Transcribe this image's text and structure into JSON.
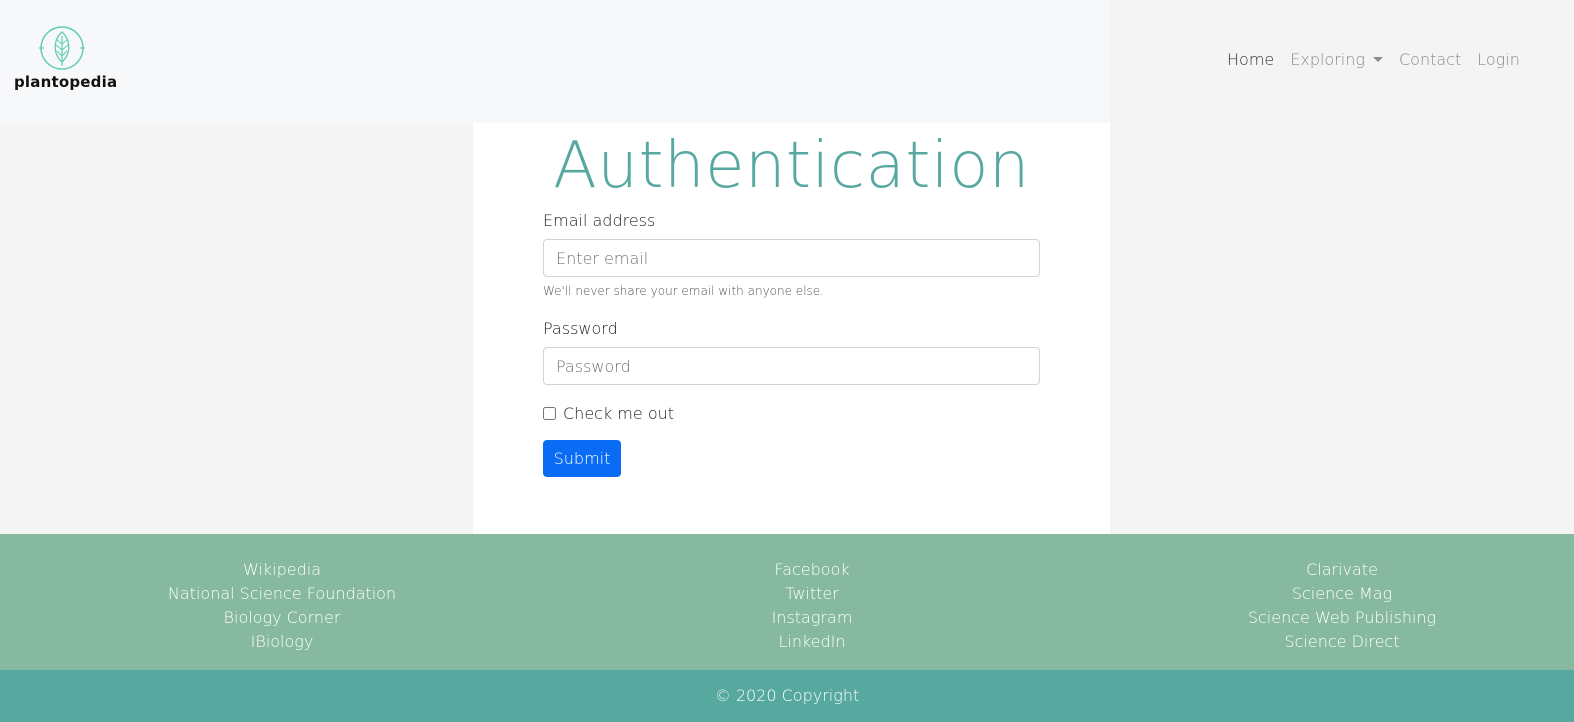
{
  "brand": {
    "name": "plantopedia",
    "icon": "leaf-icon",
    "accent": "#5ecfb0"
  },
  "nav": {
    "items": [
      {
        "label": "Home",
        "active": true
      },
      {
        "label": "Exploring",
        "dropdown": true
      },
      {
        "label": "Contact"
      },
      {
        "label": "Login"
      }
    ]
  },
  "auth": {
    "title": "Authentication",
    "email_label": "Email address",
    "email_placeholder": "Enter email",
    "email_help": "We'll never share your email with anyone else.",
    "password_label": "Password",
    "password_placeholder": "Password",
    "check_label": "Check me out",
    "submit_label": "Submit"
  },
  "footer": {
    "col1": [
      "Wikipedia",
      "National Science Foundation",
      "Biology Corner",
      "IBiology"
    ],
    "col2": [
      "Facebook",
      "Twitter",
      "Instagram",
      "LinkedIn"
    ],
    "col3": [
      "Clarivate",
      "Science Mag",
      "Science Web Publishing",
      "Science Direct"
    ],
    "copyright": "© 2020 Copyright"
  },
  "colors": {
    "title": "#56a8a0",
    "footer_bg": "#86b9a0",
    "copyright_bg": "#57a9a0",
    "button": "#0a6cf5"
  }
}
